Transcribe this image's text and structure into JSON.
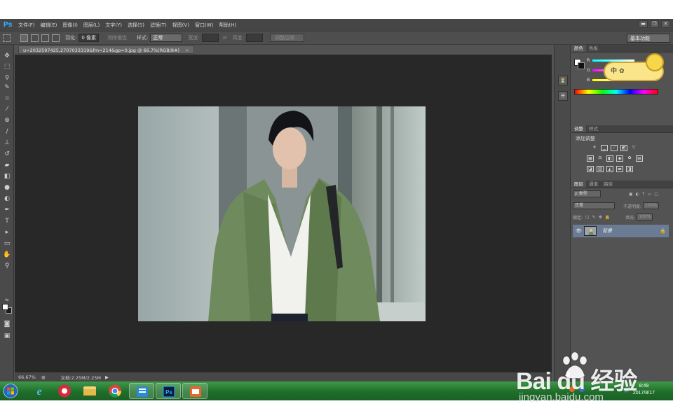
{
  "app": {
    "logo": "Ps"
  },
  "menu": [
    "文件(F)",
    "编辑(E)",
    "图像(I)",
    "图层(L)",
    "文字(Y)",
    "选择(S)",
    "滤镜(T)",
    "视图(V)",
    "窗口(W)",
    "帮助(H)"
  ],
  "window_controls": {
    "minimize": "▬",
    "restore": "❐",
    "close": "✕"
  },
  "options": {
    "feather_label": "羽化:",
    "feather_value": "0 像素",
    "antialias_label": "消除锯齿",
    "style_label": "样式:",
    "style_value": "正常",
    "width_label": "宽度:",
    "height_label": "高度:",
    "refine_edge": "调整边缘...",
    "workspace": "基本功能"
  },
  "document": {
    "tab_title": "u=2032597425,2707033319&fm=214&gp=0.jpg @ 66.7%(RGB/8#)",
    "tab_close": "×"
  },
  "status": {
    "zoom": "66.67%",
    "doc_info": "文档:2.25M/2.25M"
  },
  "panels": {
    "color_tabs": [
      "颜色",
      "色板"
    ],
    "color_channels": [
      "R",
      "G",
      "B"
    ],
    "adjust_tabs": [
      "调整",
      "样式"
    ],
    "adjust_title": "添加调整",
    "layers_tabs": [
      "图层",
      "通道",
      "路径"
    ],
    "layers_kind": "ρ 类型",
    "layers_blend": "正常",
    "layers_opacity_label": "不透明度:",
    "layers_opacity": "100%",
    "layers_lock_label": "锁定:",
    "layers_fill_label": "填充:",
    "layers_fill": "100%",
    "layer_name": "背景"
  },
  "overlay_bubble": "中 ✿",
  "taskbar": {
    "time": "8:49",
    "date": "2017/8/17",
    "apps": [
      "start",
      "ie",
      "app-red",
      "explorer",
      "chrome",
      "app-blue",
      "photoshop",
      "app-orange"
    ]
  },
  "watermark": {
    "brand": "Bai du 经验",
    "url": "jingyan.baidu.com"
  }
}
